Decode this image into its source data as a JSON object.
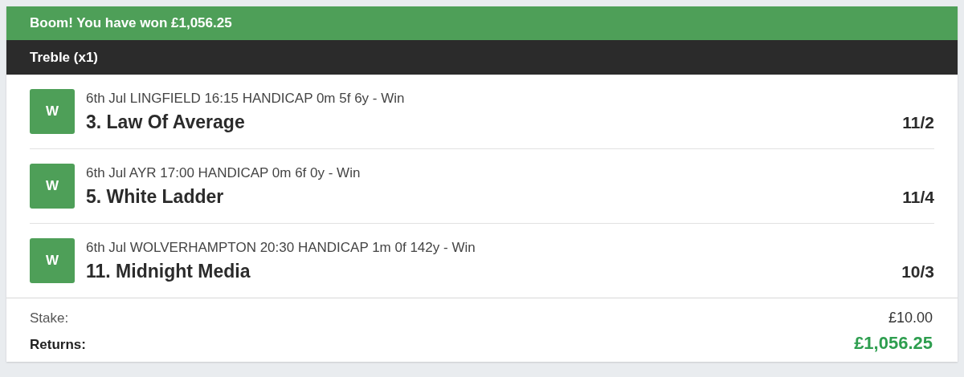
{
  "banner": {
    "message": "Boom! You have won £1,056.25"
  },
  "bet_type": "Treble (x1)",
  "legs": [
    {
      "result": "W",
      "event": "6th Jul LINGFIELD 16:15 HANDICAP 0m 5f 6y - Win",
      "selection": "3. Law Of Average",
      "odds": "11/2"
    },
    {
      "result": "W",
      "event": "6th Jul AYR 17:00 HANDICAP 0m 6f 0y - Win",
      "selection": "5. White Ladder",
      "odds": "11/4"
    },
    {
      "result": "W",
      "event": "6th Jul WOLVERHAMPTON 20:30 HANDICAP 1m 0f 142y - Win",
      "selection": "11. Midnight Media",
      "odds": "10/3"
    }
  ],
  "summary": {
    "stake_label": "Stake:",
    "stake": "£10.00",
    "returns_label": "Returns:",
    "returns": "£1,056.25"
  }
}
